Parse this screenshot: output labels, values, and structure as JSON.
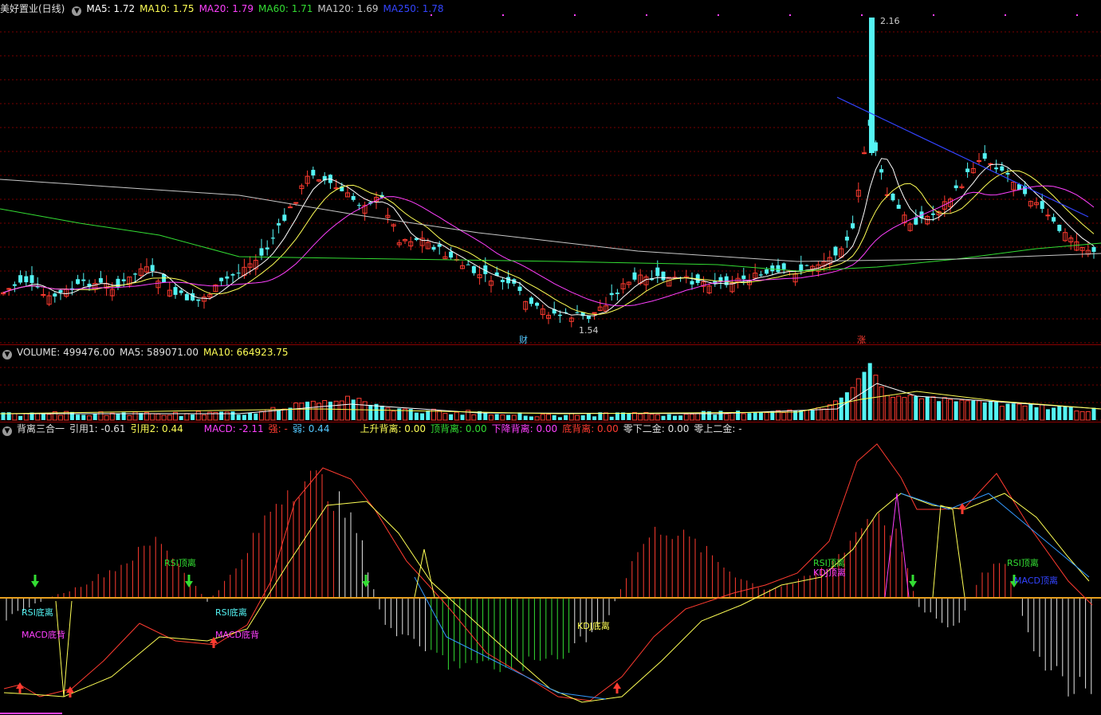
{
  "colors": {
    "up": "#ff3b30",
    "down": "#54f3f3",
    "ma5": "#ffffff",
    "ma10": "#ffff55",
    "ma20": "#ff40ff",
    "ma60": "#33dd33",
    "ma120": "#c8c8c8",
    "ma250": "#3344ff",
    "grid": "#7a0000",
    "zero": "#e8a020"
  },
  "price": {
    "stock": "美好置业(日线)",
    "ma5": "MA5: 1.72",
    "ma10": "MA10: 1.75",
    "ma20": "MA20: 1.79",
    "ma60": "MA60: 1.71",
    "ma120": "MA120: 1.69",
    "ma250": "MA250: 1.78",
    "high_label": "2.16",
    "low_label": "1.54",
    "marker_cai": "财",
    "marker_zhang": "涨"
  },
  "volume": {
    "value": "VOLUME: 499476.00",
    "ma5": "MA5: 589071.00",
    "ma10": "MA10: 664923.75"
  },
  "indicator": {
    "name": "背离三合一",
    "ref1": "引用1: -0.61",
    "ref2": "引用2: 0.44",
    "macd": "MACD: -2.11",
    "strong": "强: -",
    "weak": "弱: 0.44",
    "up_div": "上升背离: 0.00",
    "top_div": "顶背离: 0.00",
    "down_div": "下降背离: 0.00",
    "bottom_div": "底背离: 0.00",
    "below_gold": "零下二金: 0.00",
    "above_gold": "零上二金: -",
    "labels": {
      "rsi_bottom_1": "RSI底离",
      "macd_bottom_1": "MACD底背",
      "rsi_top_1": "RSI顶离",
      "rsi_bottom_2": "RSI底离",
      "macd_bottom_2": "MACD底背",
      "kdj_bottom": "KDJ底离",
      "rsi_top_2": "RSI顶离",
      "kdj_top": "KDJ顶离",
      "rsi_top_3": "RSI顶离",
      "macd_top": "MACD顶离"
    }
  }
}
